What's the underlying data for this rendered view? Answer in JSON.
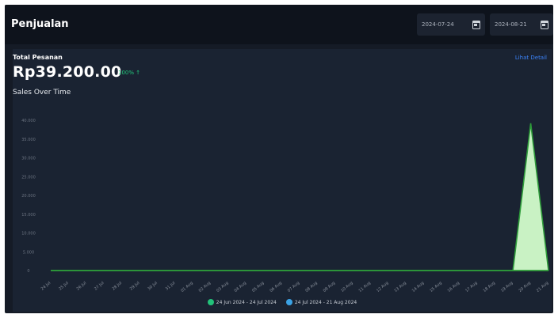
{
  "header": {
    "title": "Penjualan",
    "date_start": "2024-07-24",
    "date_end": "2024-08-21"
  },
  "card": {
    "label": "Total Pesanan",
    "link": "Lihat Detail",
    "amount": "Rp39.200.00",
    "change": "100% ↑",
    "subtitle": "Sales Over Time"
  },
  "colors": {
    "series1": "#22c27a",
    "series2": "#3ba3e6",
    "fill": "#c9f2c4",
    "line": "#2e9c3a"
  },
  "chart_data": {
    "type": "area",
    "title": "Sales Over Time",
    "ylim": [
      0,
      40000
    ],
    "y_ticks": [
      0,
      5000,
      10000,
      15000,
      20000,
      25000,
      30000,
      35000,
      40000
    ],
    "y_tick_labels": [
      "0",
      "5.000",
      "10.000",
      "15.000",
      "20.000",
      "25.000",
      "30.000",
      "35.000",
      "40.000"
    ],
    "categories": [
      "24 Jul",
      "25 Jul",
      "26 Jul",
      "27 Jul",
      "28 Jul",
      "29 Jul",
      "30 Jul",
      "31 Jul",
      "01 Aug",
      "02 Aug",
      "03 Aug",
      "04 Aug",
      "05 Aug",
      "06 Aug",
      "07 Aug",
      "08 Aug",
      "09 Aug",
      "10 Aug",
      "11 Aug",
      "12 Aug",
      "13 Aug",
      "14 Aug",
      "15 Aug",
      "16 Aug",
      "17 Aug",
      "18 Aug",
      "19 Aug",
      "20 Aug",
      "21 Aug"
    ],
    "series": [
      {
        "name": "24 Jun 2024 - 24 Jul 2024",
        "values": [
          0,
          0,
          0,
          0,
          0,
          0,
          0,
          0,
          0,
          0,
          0,
          0,
          0,
          0,
          0,
          0,
          0,
          0,
          0,
          0,
          0,
          0,
          0,
          0,
          0,
          0,
          0,
          0,
          0
        ]
      },
      {
        "name": "24 Jul 2024 - 21 Aug 2024",
        "values": [
          0,
          0,
          0,
          0,
          0,
          0,
          0,
          0,
          0,
          0,
          0,
          0,
          0,
          0,
          0,
          0,
          0,
          0,
          0,
          0,
          0,
          0,
          0,
          0,
          0,
          0,
          0,
          39200,
          0
        ]
      }
    ]
  }
}
